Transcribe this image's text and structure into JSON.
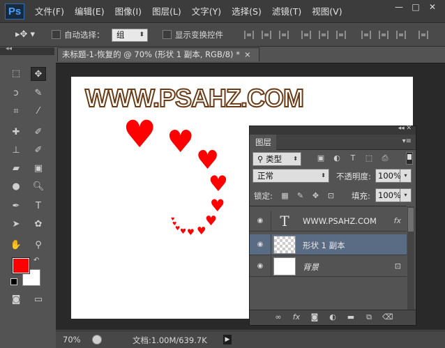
{
  "app": {
    "logo": "Ps"
  },
  "menu": [
    "文件(F)",
    "编辑(E)",
    "图像(I)",
    "图层(L)",
    "文字(Y)",
    "选择(S)",
    "滤镜(T)",
    "视图(V)"
  ],
  "window_controls": {
    "minimize": "—",
    "maximize": "□",
    "close": "✕"
  },
  "options": {
    "auto_select_label": "自动选择：",
    "auto_select_value": "组",
    "show_transform_label": "显示变换控件"
  },
  "document": {
    "tab_title": "未标题-1-恢复的 @ 70% (形状 1 副本, RGB/8) *",
    "close": "×",
    "watermark": "WWW.PSAHZ.COM"
  },
  "colors": {
    "foreground": "#ff0000",
    "background": "#ffffff",
    "heart": "#ff0000"
  },
  "status": {
    "zoom": "70%",
    "doc_info": "文档:1.00M/639.7K"
  },
  "layers_panel": {
    "tab": "图层",
    "kind_filter": "类型",
    "blend_mode": "正常",
    "opacity_label": "不透明度:",
    "opacity_value": "100%",
    "lock_label": "锁定:",
    "fill_label": "填充:",
    "fill_value": "100%",
    "layers": [
      {
        "name": "WWW.PSAHZ.COM",
        "type": "text",
        "badge": "fx",
        "selected": false
      },
      {
        "name": "形状 1 副本",
        "type": "shape",
        "selected": true
      },
      {
        "name": "背景",
        "type": "background",
        "locked": true,
        "selected": false
      }
    ]
  },
  "icons": {
    "eye": "eye-icon",
    "text_thumb": "T",
    "fx": "fx",
    "lock": "lock-icon"
  }
}
